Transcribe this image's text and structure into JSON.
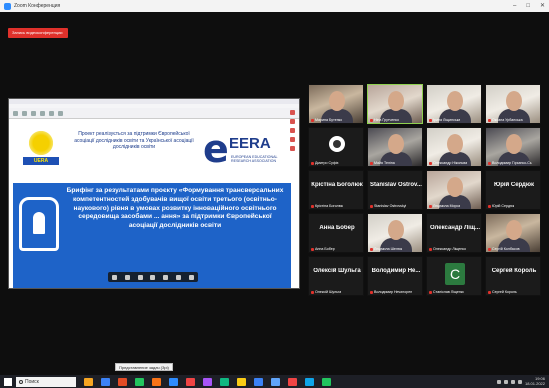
{
  "window": {
    "title": "Zoom Конференция",
    "controls": [
      "–",
      "□",
      "✕"
    ]
  },
  "recording_badge": "Запись видеоконференции",
  "shared_screen": {
    "slide": {
      "support_text": "Проект реалізується за підтримки Європейської асоціації дослідників освіти та Української асоціації дослідників освіти",
      "uera_logo_text": "UERA",
      "eera_logo_word": "EERA",
      "eera_logo_sub": "EUROPEAN EDUCATIONAL RESEARCH ASSOCIATION",
      "body_text": "Брифінг за результатами проєкту «Формування трансверсальних компетентностей здобувачів вищої освіти третього (освітньо-наукового) рівня в умовах розвитку інноваційного освітнього середовища засобами ... ання» за підтримки Європейської асоціації дослідників освіти"
    }
  },
  "participants": [
    {
      "id": "p1",
      "caption": "Марина Бутенко",
      "kind": "video",
      "variant": "",
      "active": false
    },
    {
      "id": "p2",
      "caption": "Ніна Ґрутченко",
      "kind": "video",
      "variant": "alt1",
      "active": true
    },
    {
      "id": "p3",
      "caption": "Ірина Ліщинська",
      "kind": "video",
      "variant": "alt3",
      "active": false
    },
    {
      "id": "p4",
      "caption": "Оксана Урбанська",
      "kind": "video",
      "variant": "alt3",
      "active": false
    },
    {
      "id": "p5",
      "caption": "Дмитро Суфіє",
      "kind": "obs",
      "variant": "",
      "active": false
    },
    {
      "id": "p6",
      "caption": "Майя Теліна",
      "kind": "video",
      "variant": "alt2",
      "active": false
    },
    {
      "id": "p7",
      "caption": "Олександр Нікольва",
      "kind": "video",
      "variant": "alt3",
      "active": false
    },
    {
      "id": "p8",
      "caption": "Володимир Гірьєнко-Сь",
      "kind": "video",
      "variant": "alt2",
      "active": false
    },
    {
      "id": "p9",
      "bigname": "Крістіна Боголюк",
      "caption": "Крістіна Боголюк",
      "kind": "name",
      "active": false
    },
    {
      "id": "p10",
      "bigname": "Stanislav Ostrov...",
      "caption": "Stanislav Ostrovskyi",
      "kind": "name",
      "active": false
    },
    {
      "id": "p11",
      "caption": "Людмила Мороз",
      "kind": "video",
      "variant": "alt1",
      "active": false
    },
    {
      "id": "p12",
      "bigname": "Юрій Сердюк",
      "caption": "Юрій Сердюк",
      "kind": "name",
      "active": false
    },
    {
      "id": "p13",
      "bigname": "Анна Бобер",
      "caption": "Анна Бобер",
      "kind": "name",
      "active": false
    },
    {
      "id": "p14",
      "caption": "Людмила Шелюк",
      "kind": "video",
      "variant": "alt3",
      "active": false
    },
    {
      "id": "p15",
      "bigname": "Олександр Ліщ...",
      "caption": "Олександр Ліщенко",
      "kind": "name",
      "active": false
    },
    {
      "id": "p16",
      "caption": "Сергій Колбасов",
      "kind": "video",
      "variant": "",
      "active": false
    },
    {
      "id": "p17",
      "bigname": "Олексій Шульга",
      "caption": "Олексій Шульга",
      "kind": "name",
      "active": false
    },
    {
      "id": "p18",
      "bigname": "Володимир Не...",
      "caption": "Володимир Нечипорен",
      "kind": "name",
      "active": false
    },
    {
      "id": "p19",
      "caption": "Станіслав Ліщенко",
      "kind": "letter",
      "letter": "С",
      "active": false
    },
    {
      "id": "p20",
      "bigname": "Сергей Король",
      "caption": "Сергей Король",
      "kind": "name",
      "active": false
    }
  ],
  "tooltip": "Представление задач (Зрі)",
  "taskbar": {
    "search_placeholder": "Поиск",
    "clock_time": "19:06",
    "clock_date": "18.01.2022",
    "apps": [
      "#f6a623",
      "#3b82f6",
      "#e34c26",
      "#22c55e",
      "#f97316",
      "#2d8cff",
      "#ef4444",
      "#a855f7",
      "#10b981",
      "#facc15",
      "#3b82f6",
      "#60a5fa",
      "#ef4444",
      "#0ea5e9",
      "#22c55e"
    ]
  },
  "colors": {
    "recording": "#e0312b",
    "active_speaker": "#8fd14f",
    "slide_blue": "#1e63c8"
  }
}
